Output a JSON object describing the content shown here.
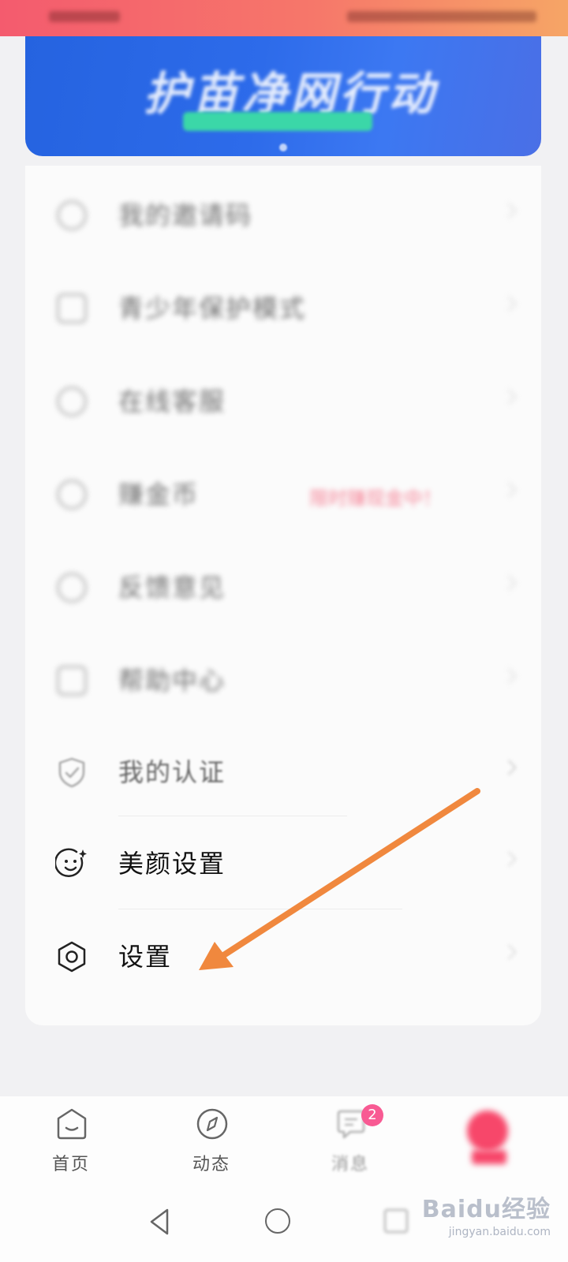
{
  "banner": {
    "title": "护苗净网行动"
  },
  "menu": {
    "items": [
      {
        "label": "我的邀请码"
      },
      {
        "label": "青少年保护模式"
      },
      {
        "label": "在线客服"
      },
      {
        "label": "赚金币",
        "badge": "限时赚现金中！"
      },
      {
        "label": "反馈意见"
      },
      {
        "label": "帮助中心"
      },
      {
        "label": "我的认证"
      },
      {
        "label": "美颜设置"
      },
      {
        "label": "设置"
      }
    ]
  },
  "tab_bar": {
    "tabs": [
      {
        "label": "首页"
      },
      {
        "label": "动态"
      },
      {
        "label": "消息",
        "badge": "2"
      },
      {
        "label": ""
      }
    ]
  },
  "colors": {
    "accent": "#f7476a",
    "arrow": "#f0883e",
    "banner": "#2563e0",
    "badge": "#f85a93"
  },
  "watermark": {
    "logo": "Baidu经验",
    "url": "jingyan.baidu.com"
  }
}
